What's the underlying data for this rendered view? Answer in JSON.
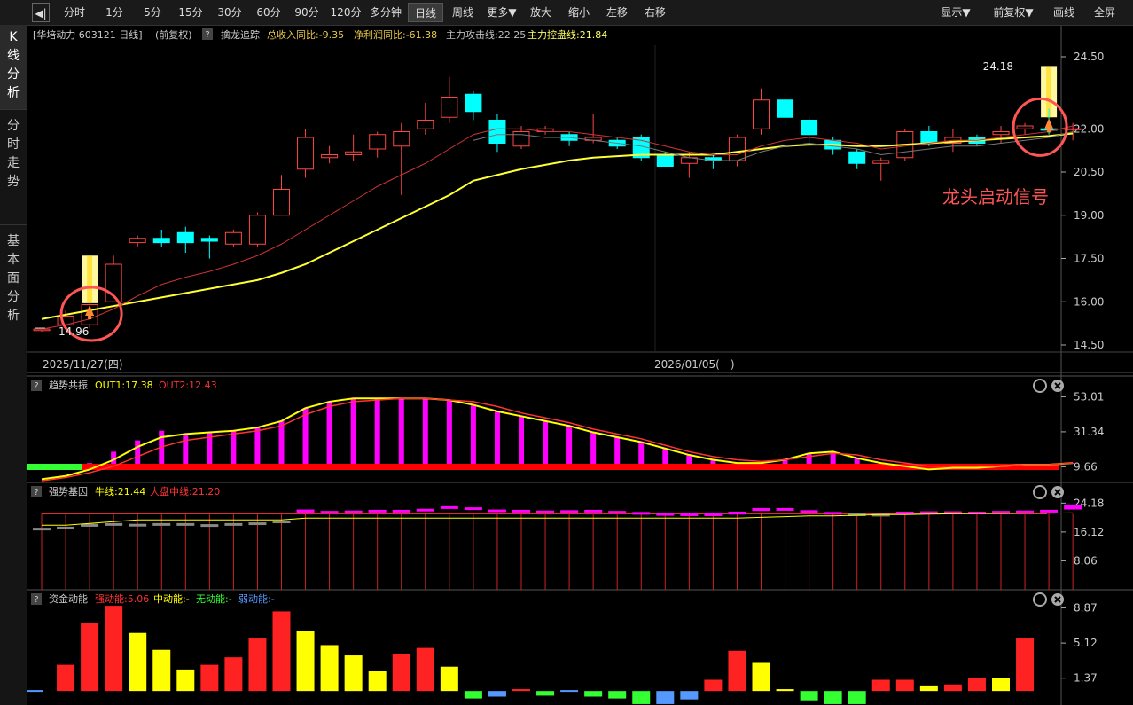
{
  "toolbar": {
    "items": [
      "分时",
      "1分",
      "5分",
      "15分",
      "30分",
      "60分",
      "90分",
      "120分",
      "多分钟",
      "日线",
      "周线",
      "更多▼",
      "放大",
      "缩小",
      "左移",
      "右移"
    ],
    "right_items": [
      "显示▼",
      "前复权▼",
      "画线",
      "全屏"
    ],
    "active": "日线"
  },
  "sidebar": {
    "tabs": [
      [
        "K",
        "线",
        "分",
        "析"
      ],
      [
        "分",
        "时",
        "走",
        "势"
      ],
      [
        "基",
        "本",
        "面",
        "分",
        "析"
      ]
    ]
  },
  "main": {
    "header_name": "[华培动力 603121 日线]",
    "header_mode": "(前复权)",
    "indicator_name": "擒龙追踪",
    "values": [
      {
        "text": "总收入同比:-9.35",
        "color": "#e6c84a"
      },
      {
        "text": "净利润同比:-61.38",
        "color": "#e6c84a"
      },
      {
        "text": "主力攻击线:22.25",
        "color": "#bfbfbf"
      },
      {
        "text": "主力控盘线:21.84",
        "color": "#ffff66"
      }
    ],
    "annotation": "龙头启动信号",
    "max_label": "24.18",
    "min_label": "14.96",
    "date_left": "2025/11/27(四)",
    "date_right": "2026/01/05(一)",
    "y_ticks": [
      "24.50",
      "22.00",
      "20.50",
      "19.00",
      "17.50",
      "16.00",
      "14.50"
    ]
  },
  "panel2": {
    "title": "趋势共振",
    "values": [
      {
        "text": "OUT1:17.38",
        "color": "#ffff00"
      },
      {
        "text": "OUT2:12.43",
        "color": "#ff3333"
      }
    ],
    "y_ticks": [
      "53.01",
      "31.34",
      "9.66"
    ]
  },
  "panel3": {
    "title": "强势基因",
    "values": [
      {
        "text": "牛线:21.44",
        "color": "#ffff00"
      },
      {
        "text": "大盘中线:21.20",
        "color": "#ff3333"
      }
    ],
    "y_ticks": [
      "24.18",
      "16.12",
      "8.06"
    ]
  },
  "panel4": {
    "title": "资金动能",
    "values": [
      {
        "text": "强动能:5.06",
        "color": "#ff3333"
      },
      {
        "text": "中动能:-",
        "color": "#ffff00"
      },
      {
        "text": "无动能:-",
        "color": "#33ff33"
      },
      {
        "text": "弱动能:-",
        "color": "#5599ff"
      }
    ],
    "y_ticks": [
      "8.87",
      "5.12",
      "1.37"
    ]
  },
  "chart_data": [
    {
      "type": "candlestick",
      "title": "[华培动力 603121 日线]",
      "y_range": [
        14.5,
        24.9
      ],
      "x_labels": [
        "2025/11/27(四)",
        "2026/01/05(一)"
      ],
      "candles": [
        [
          15.05,
          15.0,
          15.1,
          14.96,
          "up"
        ],
        [
          15.2,
          15.5,
          15.7,
          15.1,
          "up"
        ],
        [
          15.2,
          15.9,
          16.0,
          15.1,
          "up"
        ],
        [
          16.0,
          17.3,
          17.6,
          16.0,
          "up"
        ],
        [
          18.05,
          18.2,
          18.3,
          17.9,
          "up"
        ],
        [
          18.2,
          18.05,
          18.5,
          17.9,
          "down"
        ],
        [
          18.4,
          18.05,
          18.6,
          17.7,
          "down"
        ],
        [
          18.2,
          18.1,
          18.3,
          17.5,
          "down"
        ],
        [
          18.0,
          18.4,
          18.5,
          17.9,
          "up"
        ],
        [
          18.0,
          19.0,
          19.1,
          17.9,
          "up"
        ],
        [
          19.0,
          19.9,
          20.4,
          19.0,
          "up"
        ],
        [
          20.6,
          21.7,
          22.0,
          20.3,
          "up"
        ],
        [
          21.0,
          21.1,
          21.4,
          20.8,
          "up"
        ],
        [
          21.1,
          21.2,
          21.8,
          20.9,
          "up"
        ],
        [
          21.3,
          21.8,
          21.9,
          21.0,
          "up"
        ],
        [
          21.4,
          21.9,
          22.2,
          19.7,
          "up"
        ],
        [
          22.0,
          22.3,
          22.9,
          21.8,
          "up"
        ],
        [
          22.4,
          23.1,
          23.8,
          22.2,
          "up"
        ],
        [
          23.2,
          22.6,
          23.3,
          22.3,
          "down"
        ],
        [
          22.3,
          21.5,
          22.5,
          21.2,
          "down"
        ],
        [
          21.4,
          21.9,
          22.1,
          21.3,
          "up"
        ],
        [
          21.9,
          22.0,
          22.1,
          21.8,
          "up"
        ],
        [
          21.8,
          21.6,
          21.9,
          21.4,
          "down"
        ],
        [
          21.6,
          21.7,
          22.5,
          21.5,
          "up"
        ],
        [
          21.6,
          21.4,
          21.7,
          21.3,
          "down"
        ],
        [
          21.7,
          21.0,
          21.8,
          20.9,
          "down"
        ],
        [
          21.1,
          20.7,
          21.2,
          20.7,
          "down"
        ],
        [
          20.8,
          21.0,
          21.2,
          20.3,
          "up"
        ],
        [
          20.9,
          21.0,
          21.1,
          20.6,
          "down"
        ],
        [
          20.9,
          21.7,
          21.8,
          20.7,
          "up"
        ],
        [
          22.0,
          23.0,
          23.4,
          21.8,
          "up"
        ],
        [
          23.0,
          22.4,
          23.2,
          22.1,
          "down"
        ],
        [
          22.3,
          21.8,
          22.4,
          21.4,
          "down"
        ],
        [
          21.6,
          21.3,
          21.7,
          21.1,
          "down"
        ],
        [
          21.2,
          20.8,
          21.3,
          20.6,
          "down"
        ],
        [
          20.8,
          20.9,
          21.0,
          20.2,
          "up"
        ],
        [
          21.0,
          21.9,
          22.0,
          20.9,
          "up"
        ],
        [
          21.9,
          21.5,
          22.1,
          21.4,
          "down"
        ],
        [
          21.5,
          21.7,
          22.0,
          21.2,
          "up"
        ],
        [
          21.7,
          21.5,
          21.8,
          21.4,
          "down"
        ],
        [
          21.8,
          21.9,
          22.1,
          21.5,
          "up"
        ],
        [
          22.0,
          22.1,
          22.2,
          21.8,
          "up"
        ],
        [
          22.0,
          21.95,
          22.7,
          21.8,
          "down"
        ],
        [
          22.0,
          22.0,
          22.2,
          21.6,
          "up"
        ]
      ],
      "highlight_bars": [
        {
          "index": 2,
          "from": 15.95,
          "to": 17.6
        },
        {
          "index": 42,
          "from": 22.4,
          "to": 24.18
        }
      ],
      "ma_fast": [
        15.05,
        15.2,
        15.4,
        15.75,
        16.2,
        16.6,
        16.85,
        17.05,
        17.3,
        17.6,
        18.0,
        18.5,
        19.0,
        19.5,
        20.0,
        20.4,
        20.8,
        21.3,
        21.8,
        22.0,
        22.0,
        21.9,
        21.9,
        21.8,
        21.7,
        21.6,
        21.4,
        21.2,
        21.1,
        21.1,
        21.4,
        21.6,
        21.7,
        21.6,
        21.5,
        21.3,
        21.4,
        21.5,
        21.6,
        21.6,
        21.7,
        21.8,
        21.9,
        22.1
      ],
      "ma_slow": [
        15.4,
        15.55,
        15.7,
        15.85,
        16.0,
        16.15,
        16.3,
        16.45,
        16.6,
        16.75,
        17.0,
        17.3,
        17.7,
        18.1,
        18.5,
        18.9,
        19.3,
        19.7,
        20.2,
        20.4,
        20.6,
        20.75,
        20.9,
        21.0,
        21.05,
        21.1,
        21.1,
        21.1,
        21.1,
        21.2,
        21.3,
        21.4,
        21.45,
        21.45,
        21.4,
        21.4,
        21.45,
        21.5,
        21.55,
        21.6,
        21.65,
        21.7,
        21.75,
        21.84
      ],
      "signals": [
        2,
        42
      ]
    },
    {
      "type": "bar",
      "title": "趋势共振",
      "y_range": [
        0,
        56
      ],
      "bar_color": "#ff00ff",
      "series": [
        {
          "name": "OUT1:17.38",
          "color": "#ffff00",
          "values": [
            2,
            4,
            8,
            14,
            22,
            28,
            30,
            31,
            32,
            34,
            38,
            46,
            50,
            52,
            52,
            52,
            52,
            51,
            48,
            44,
            41,
            38,
            35,
            31,
            28,
            25,
            21,
            17,
            14,
            12,
            12,
            14,
            18,
            19,
            15,
            12,
            10,
            8,
            9,
            9,
            10,
            11,
            11,
            12,
            17
          ]
        },
        {
          "name": "OUT2:12.43",
          "color": "#ff3333",
          "values": [
            1,
            3,
            6,
            10,
            16,
            22,
            26,
            28,
            30,
            32,
            35,
            42,
            47,
            50,
            51,
            52,
            52,
            51,
            50,
            47,
            43,
            40,
            37,
            33,
            30,
            27,
            23,
            19,
            16,
            14,
            13,
            14,
            16,
            18,
            17,
            14,
            12,
            10,
            10,
            10,
            10,
            11,
            11,
            12,
            13
          ]
        }
      ],
      "values": [
        0,
        6,
        12,
        19,
        26,
        32,
        30,
        31,
        32,
        34,
        38,
        46,
        50,
        52,
        52,
        52,
        52,
        51,
        48,
        44,
        41,
        38,
        35,
        31,
        28,
        25,
        21,
        17,
        14,
        12,
        12,
        14,
        18,
        19,
        15,
        12,
        10,
        8,
        9,
        9,
        10,
        11,
        11,
        12,
        17
      ]
    },
    {
      "type": "bar",
      "title": "强势基因",
      "y_range": [
        0,
        26
      ],
      "series": [
        {
          "name": "牛线:21.44",
          "color": "#ffff00",
          "values": [
            18,
            18,
            18.5,
            19,
            19.5,
            19.5,
            19.5,
            19.5,
            19.5,
            19.5,
            19.5,
            20,
            20,
            20,
            20,
            20,
            20,
            20,
            20,
            20,
            20,
            20,
            20,
            20,
            20,
            20,
            20,
            20,
            20,
            20,
            20.2,
            20.4,
            20.6,
            20.6,
            20.8,
            21,
            21,
            21.1,
            21.2,
            21.3,
            21.3,
            21.4,
            21.4,
            21.44
          ]
        },
        {
          "name": "大盘中线:21.20",
          "color": "#ff3333",
          "values": [
            21.2,
            21.2,
            21.2,
            21.2,
            21.2,
            21.2,
            21.2,
            21.2,
            21.2,
            21.2,
            21.2,
            21.2,
            21.2,
            21.2,
            21.2,
            21.2,
            21.2,
            21.2,
            21.2,
            21.2,
            21.2,
            21.2,
            21.2,
            21.2,
            21.2,
            21.2,
            21.2,
            21.2,
            21.2,
            21.2,
            21.2,
            21.2,
            21.2,
            21.2,
            21.2,
            21.2,
            21.2,
            21.2,
            21.2,
            21.2,
            21.2,
            21.2,
            21.2,
            21.2
          ]
        }
      ],
      "bars": [
        [
          17.0,
          17.3,
          "#888"
        ],
        [
          17.2,
          17.6,
          "#888"
        ],
        [
          17.6,
          18.4,
          "#888"
        ],
        [
          18.2,
          18.6,
          "#888"
        ],
        [
          18.2,
          18.4,
          "#888"
        ],
        [
          18.3,
          18.6,
          "#888"
        ],
        [
          18.4,
          18.6,
          "#888"
        ],
        [
          18.1,
          18.3,
          "#888"
        ],
        [
          18.4,
          18.6,
          "#888"
        ],
        [
          18.5,
          18.8,
          "#888"
        ],
        [
          18.8,
          19.3,
          "#888"
        ],
        [
          21.4,
          22.4,
          "#ff00ff"
        ],
        [
          21.6,
          22.0,
          "#ff00ff"
        ],
        [
          21.8,
          22.1,
          "#ff00ff"
        ],
        [
          21.8,
          22.3,
          "#ff00ff"
        ],
        [
          21.8,
          22.3,
          "#ff00ff"
        ],
        [
          22.2,
          22.6,
          "#ff00ff"
        ],
        [
          22.8,
          23.3,
          "#ff00ff"
        ],
        [
          22.4,
          23.0,
          "#ff00ff"
        ],
        [
          21.8,
          22.4,
          "#ff00ff"
        ],
        [
          21.8,
          22.3,
          "#ff00ff"
        ],
        [
          21.7,
          22.1,
          "#ff00ff"
        ],
        [
          21.8,
          22.2,
          "#ff00ff"
        ],
        [
          21.6,
          22.3,
          "#ff00ff"
        ],
        [
          21.6,
          22.0,
          "#ff00ff"
        ],
        [
          21.1,
          21.7,
          "#ff00ff"
        ],
        [
          21.0,
          21.4,
          "#ff00ff"
        ],
        [
          20.9,
          21.3,
          "#ff00ff"
        ],
        [
          20.9,
          21.3,
          "#ff00ff"
        ],
        [
          21.0,
          21.8,
          "#ff00ff"
        ],
        [
          22.0,
          22.8,
          "#ff00ff"
        ],
        [
          22.2,
          22.8,
          "#ff00ff"
        ],
        [
          21.6,
          22.2,
          "#ff00ff"
        ],
        [
          21.3,
          21.7,
          "#ff00ff"
        ],
        [
          20.9,
          21.3,
          "#888"
        ],
        [
          20.9,
          21.2,
          "#888"
        ],
        [
          21.2,
          21.8,
          "#ff00ff"
        ],
        [
          21.4,
          21.9,
          "#ff00ff"
        ],
        [
          21.4,
          21.9,
          "#ff00ff"
        ],
        [
          21.4,
          21.8,
          "#ff00ff"
        ],
        [
          21.5,
          22.0,
          "#ff00ff"
        ],
        [
          21.7,
          22.1,
          "#ff00ff"
        ],
        [
          21.8,
          22.3,
          "#ff00ff"
        ],
        [
          22.4,
          23.8,
          "#ff00ff"
        ]
      ]
    },
    {
      "type": "bar",
      "title": "资金动能",
      "y_range": [
        -1.5,
        9.3
      ],
      "values": [
        [
          0.1,
          "#5599ff"
        ],
        [
          2.8,
          "#ff2222"
        ],
        [
          7.3,
          "#ff2222"
        ],
        [
          9.1,
          "#ff2222"
        ],
        [
          6.2,
          "#ffff00"
        ],
        [
          4.4,
          "#ffff00"
        ],
        [
          2.3,
          "#ffff00"
        ],
        [
          2.8,
          "#ff2222"
        ],
        [
          3.6,
          "#ff2222"
        ],
        [
          5.6,
          "#ff2222"
        ],
        [
          8.5,
          "#ff2222"
        ],
        [
          6.4,
          "#ffff00"
        ],
        [
          4.9,
          "#ffff00"
        ],
        [
          3.8,
          "#ffff00"
        ],
        [
          2.1,
          "#ffff00"
        ],
        [
          3.9,
          "#ff2222"
        ],
        [
          4.6,
          "#ff2222"
        ],
        [
          2.6,
          "#ffff00"
        ],
        [
          -0.8,
          "#33ff33"
        ],
        [
          -0.6,
          "#5599ff"
        ],
        [
          0.2,
          "#ff2222"
        ],
        [
          -0.5,
          "#33ff33"
        ],
        [
          0.1,
          "#5599ff"
        ],
        [
          -0.6,
          "#33ff33"
        ],
        [
          -0.8,
          "#33ff33"
        ],
        [
          -1.4,
          "#33ff33"
        ],
        [
          -1.4,
          "#5599ff"
        ],
        [
          -0.9,
          "#5599ff"
        ],
        [
          1.2,
          "#ff2222"
        ],
        [
          4.3,
          "#ff2222"
        ],
        [
          3.0,
          "#ffff00"
        ],
        [
          0.2,
          "#ffff00"
        ],
        [
          -1.0,
          "#33ff33"
        ],
        [
          -1.4,
          "#33ff33"
        ],
        [
          -1.4,
          "#33ff33"
        ],
        [
          1.2,
          "#ff2222"
        ],
        [
          1.2,
          "#ff2222"
        ],
        [
          0.5,
          "#ffff00"
        ],
        [
          0.7,
          "#ff2222"
        ],
        [
          1.4,
          "#ff2222"
        ],
        [
          1.4,
          "#ffff00"
        ],
        [
          5.6,
          "#ff2222"
        ]
      ]
    }
  ]
}
